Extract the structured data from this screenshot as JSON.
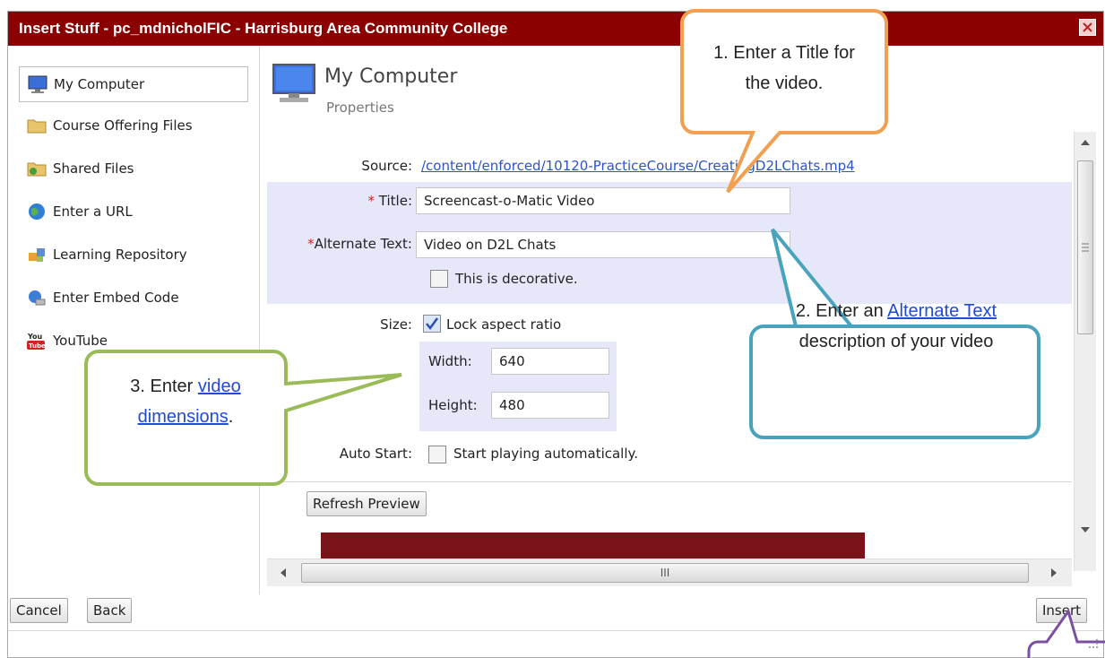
{
  "dialog": {
    "title": "Insert Stuff - pc_mdnicholFIC - Harrisburg Area Community College"
  },
  "sidebar": {
    "items": [
      {
        "label": "My Computer",
        "icon": "monitor-icon"
      },
      {
        "label": "Course Offering Files",
        "icon": "folder-icon"
      },
      {
        "label": "Shared Files",
        "icon": "shared-folder-icon"
      },
      {
        "label": "Enter a URL",
        "icon": "globe-icon"
      },
      {
        "label": "Learning Repository",
        "icon": "puzzle-icon"
      },
      {
        "label": "Enter Embed Code",
        "icon": "embed-icon"
      },
      {
        "label": "YouTube",
        "icon": "youtube-icon"
      }
    ]
  },
  "main": {
    "heading": "My Computer",
    "subheading": "Properties",
    "source_label": "Source:",
    "source_value": "/content/enforced/10120-PracticeCourse/CreatingD2LChats.mp4",
    "title_label": "Title:",
    "title_value": "Screencast-o-Matic Video",
    "alt_label": "Alternate Text:",
    "alt_value": "Video on D2L Chats",
    "decorative_label": "This is decorative.",
    "size_label": "Size:",
    "lock_label": "Lock aspect ratio",
    "width_label": "Width:",
    "width_value": "640",
    "height_label": "Height:",
    "height_value": "480",
    "autostart_label": "Auto Start:",
    "autostart_option": "Start playing automatically.",
    "refresh_label": "Refresh Preview",
    "hscroll_grip": "III"
  },
  "footer": {
    "cancel": "Cancel",
    "back": "Back",
    "insert": "Insert"
  },
  "callouts": {
    "c1": "1. Enter a Title for the video.",
    "c2_prefix": "2. Enter an ",
    "c2_link": "Alternate Text",
    "c2_suffix": " description of your video",
    "c3_prefix": "3. Enter ",
    "c3_link": "video dimensions",
    "c3_suffix": "."
  },
  "colors": {
    "titlebar": "#8b0000",
    "highlight": "#e6e8fa",
    "callout1": "#f0a050",
    "callout2": "#4aa3bd",
    "callout3": "#9bbb59",
    "callout4": "#7b4fa0"
  }
}
